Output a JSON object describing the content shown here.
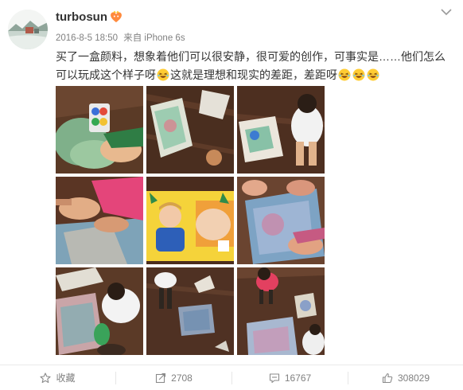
{
  "user": {
    "name": "turbosun"
  },
  "post": {
    "date": "2016-8-5 18:50",
    "via": "来自 iPhone 6s",
    "text_line1": "买了一盒颜料，想象着他们可以很安静，很可爱的创作，可事实是……他们怎么",
    "text_line2a": "可以玩成这个样子呀",
    "text_line2b": "这就是理想和现实的差距，差距呀"
  },
  "actions": {
    "favorite_label": "收藏",
    "repost_count": "2708",
    "comment_count": "16767",
    "like_count": "308029"
  }
}
